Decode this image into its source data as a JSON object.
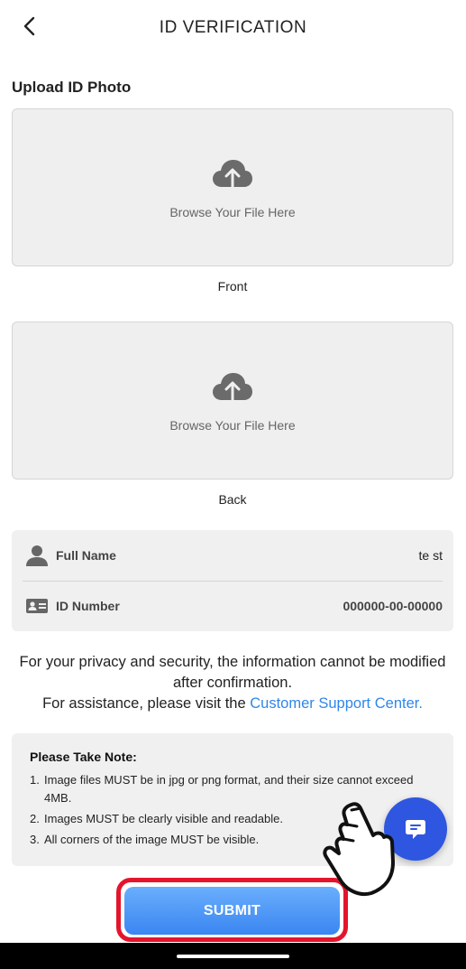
{
  "header": {
    "title": "ID VERIFICATION",
    "back_icon": "chevron-left-icon"
  },
  "upload": {
    "section_title": "Upload ID Photo",
    "front": {
      "prompt": "Browse Your File Here",
      "caption": "Front",
      "icon": "cloud-upload-icon"
    },
    "back": {
      "prompt": "Browse Your File Here",
      "caption": "Back",
      "icon": "cloud-upload-icon"
    }
  },
  "info": {
    "full_name_label": "Full Name",
    "full_name_value": "te st",
    "full_name_icon": "user-icon",
    "id_number_label": "ID Number",
    "id_number_value": "000000-00-00000",
    "id_number_icon": "id-card-icon"
  },
  "privacy": {
    "line1": "For your privacy and security, the information cannot be modified after confirmation.",
    "line2_prefix": "For assistance, please visit the ",
    "link_text": "Customer Support Center."
  },
  "note": {
    "title": "Please Take Note:",
    "items": [
      {
        "num": "1.",
        "text": "Image files MUST be in jpg or png format, and their size cannot exceed 4MB."
      },
      {
        "num": "2.",
        "text": "Images MUST be clearly visible and readable."
      },
      {
        "num": "3.",
        "text": "All corners of the image MUST be visible."
      }
    ]
  },
  "chat": {
    "icon": "chat-message-icon"
  },
  "submit": {
    "label": "SUBMIT"
  },
  "colors": {
    "accent": "#2f86ea",
    "submit_gradient_top": "#6aaefc",
    "submit_gradient_bottom": "#3a86f2",
    "highlight": "#e5142d",
    "chat_fab": "#2e56e0"
  }
}
